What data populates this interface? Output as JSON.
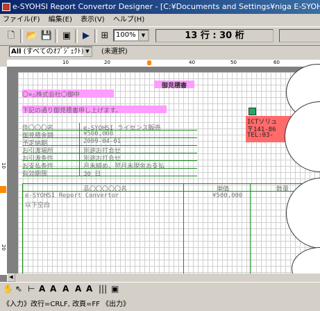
{
  "title": "e-SYOHSI Report Convertor Designer - [C:¥Documents and Settings¥niga E-SYOHSI-PC¥デスクトップ¥デザイナ-",
  "menu": [
    "ファイル(F)",
    "編集(E)",
    "表示(V)",
    "ヘルプ(H)"
  ],
  "toolbar": {
    "zoom": "100%",
    "position": "13 行 : 30 桁"
  },
  "object_selector": {
    "prefix": "All",
    "value": "(すべてのｵﾌﾞｼﾞｪｸﾄ)",
    "selected": "(未選択)"
  },
  "ruler": [
    "10",
    "20",
    "40",
    "50",
    "60",
    "10",
    "20"
  ],
  "document": {
    "doc_title": "御見積書",
    "customer": "〇×△株式会社〇御中",
    "intro": "下記の通り御見積書申し上げます。",
    "rows": [
      {
        "label": "件〇〇〇名",
        "value": "e-SYOHSI ライセンス販売"
      },
      {
        "label": "御見積金額",
        "value": "¥500,000"
      },
      {
        "label": "予定納期",
        "value": "2009-04-01"
      },
      {
        "label": "お引渡場所",
        "value": "別途お打合せ"
      },
      {
        "label": "お引渡条件",
        "value": "別途お打合せ"
      },
      {
        "label": "お支払条件",
        "value": "月末締め、翌月末現金お支払"
      },
      {
        "label": "有効期限",
        "value": "30 日"
      }
    ],
    "company": "ICTソリュ",
    "postal": "〒141-86",
    "tel": "TEL:03-",
    "table_header": {
      "name": "品〇〇〇〇〇名",
      "price": "単価",
      "qty": "数量"
    },
    "items": [
      {
        "name": "e-SYOHSI Report Convertor",
        "price": "¥500,000"
      },
      {
        "name": "以下空白",
        "price": ""
      }
    ]
  },
  "statusbar": "《入力》改行=CRLF, 改頁=FF 《出力》"
}
